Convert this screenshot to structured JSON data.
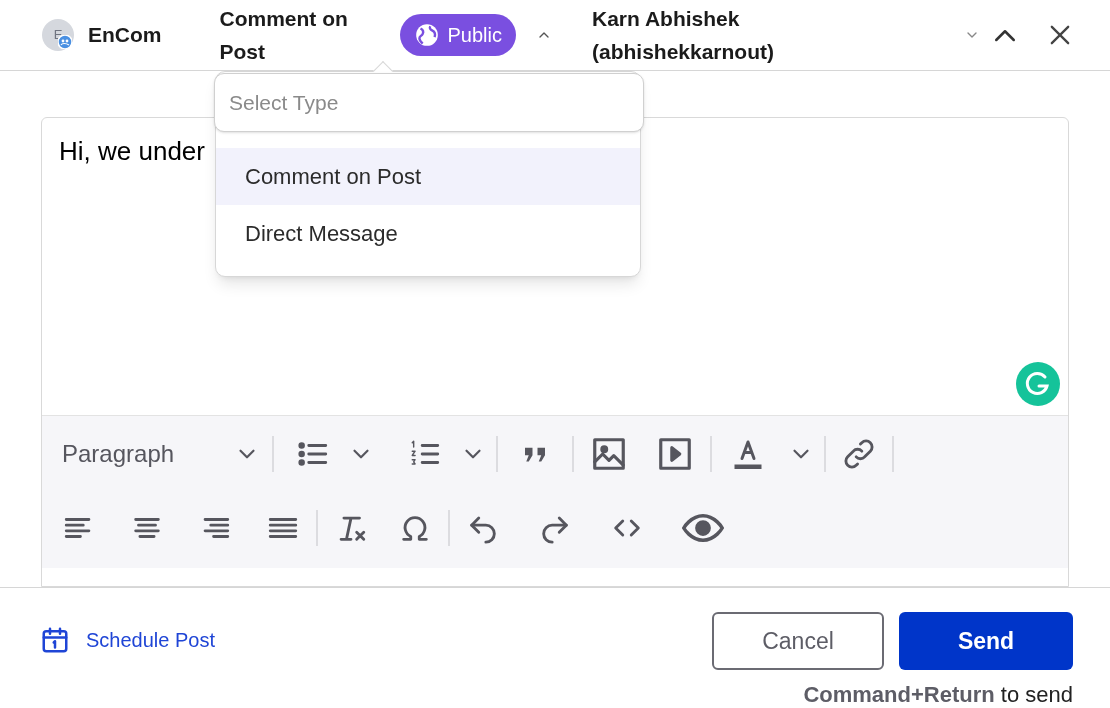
{
  "header": {
    "avatar_letter": "E",
    "account": "EnCom",
    "reply_type": "Comment on Post",
    "visibility": "Public",
    "recipient": "Karn Abhishek (abhishekkarnout)"
  },
  "type_dropdown": {
    "placeholder": "Select Type",
    "options": [
      {
        "label": "Comment on Post",
        "selected": true
      },
      {
        "label": "Direct Message",
        "selected": false
      }
    ]
  },
  "editor": {
    "text": "Hi, we under",
    "format": "Paragraph"
  },
  "footer": {
    "schedule": "Schedule Post",
    "cancel": "Cancel",
    "send": "Send",
    "hint": "**Command+Return** to send"
  }
}
